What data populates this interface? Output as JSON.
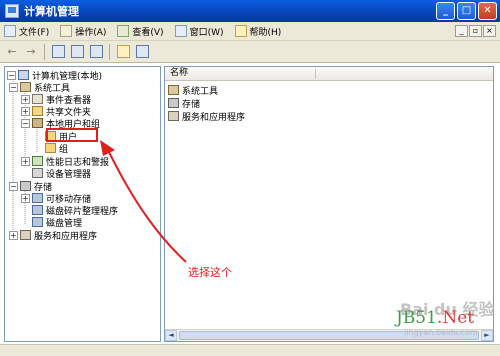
{
  "window": {
    "title": "计算机管理",
    "minimize": "_",
    "maximize": "□",
    "close": "✕"
  },
  "menubar": {
    "items": [
      {
        "label": "文件(F)",
        "icon": "file-icon"
      },
      {
        "label": "操作(A)",
        "icon": "action-icon"
      },
      {
        "label": "查看(V)",
        "icon": "view-icon"
      },
      {
        "label": "窗口(W)",
        "icon": "window-icon"
      },
      {
        "label": "帮助(H)",
        "icon": "help-icon"
      }
    ],
    "inner_min": "_",
    "inner_restore": "▫",
    "inner_close": "×"
  },
  "toolbar": {
    "back": "←",
    "forward": "→"
  },
  "tree": {
    "root": "计算机管理(本地)",
    "system_tools": "系统工具",
    "event_viewer": "事件查看器",
    "shared_folders": "共享文件夹",
    "local_users_groups": "本地用户和组",
    "users": "用户",
    "groups": "组",
    "perf_logs": "性能日志和警报",
    "device_manager": "设备管理器",
    "storage": "存储",
    "removable_storage": "可移动存储",
    "defrag": "磁盘碎片整理程序",
    "disk_mgmt": "磁盘管理",
    "services_apps": "服务和应用程序",
    "expand_plus": "+",
    "expand_minus": "−"
  },
  "list": {
    "column_name": "名称",
    "items": [
      "系统工具",
      "存储",
      "服务和应用程序"
    ]
  },
  "annotation": {
    "text": "选择这个",
    "color": "#e02020"
  },
  "watermark": {
    "baidu": "Bai du 经验",
    "jb51_a": "JB51",
    "jb51_b": ".Net",
    "url": "jingyan.baidu.com"
  }
}
